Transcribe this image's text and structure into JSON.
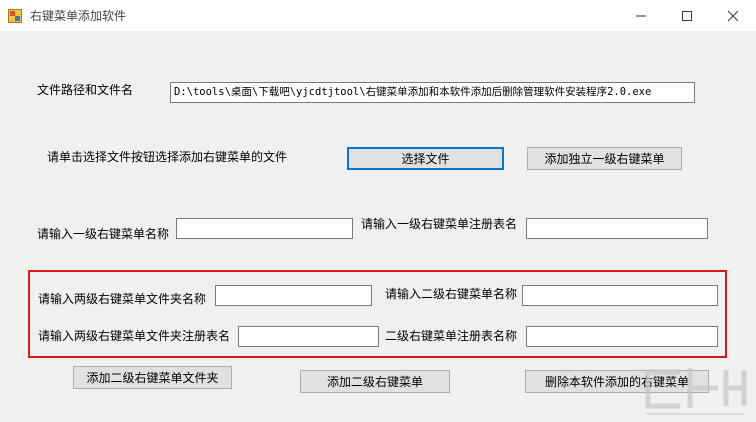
{
  "window": {
    "title": "右键菜单添加软件"
  },
  "file_path": {
    "label": "文件路径和文件名",
    "value": "D:\\tools\\桌面\\下载吧\\yjcdtjtool\\右键菜单添加和本软件添加后删除管理软件安装程序2.0.exe"
  },
  "select_row": {
    "hint": "请单击选择文件按钮选择添加右键菜单的文件",
    "select_button": "选择文件",
    "add_standalone_button": "添加独立一级右键菜单"
  },
  "level1": {
    "name_label": "请输入一级右键菜单名称",
    "name_value": "",
    "registry_label": "请输入一级右键菜单注册表名",
    "registry_value": ""
  },
  "level2": {
    "folder_name_label": "请输入两级右键菜单文件夹名称",
    "folder_name_value": "",
    "submenu_name_label": "请输入二级右键菜单名称",
    "submenu_name_value": "",
    "folder_registry_label": "请输入两级右键菜单文件夹注册表名",
    "folder_registry_value": "",
    "submenu_registry_label": "二级右键菜单注册表名称",
    "submenu_registry_value": ""
  },
  "bottom_buttons": {
    "add_folder": "添加二级右键菜单文件夹",
    "add_submenu": "添加二级右键菜单",
    "delete_added": "删除本软件添加的右键菜单"
  },
  "colors": {
    "highlight": "#e01515",
    "default_button_border": "#0078d7"
  },
  "icons": {
    "app": "app-icon",
    "minimize": "minimize-icon",
    "maximize": "maximize-icon",
    "close": "close-icon"
  }
}
